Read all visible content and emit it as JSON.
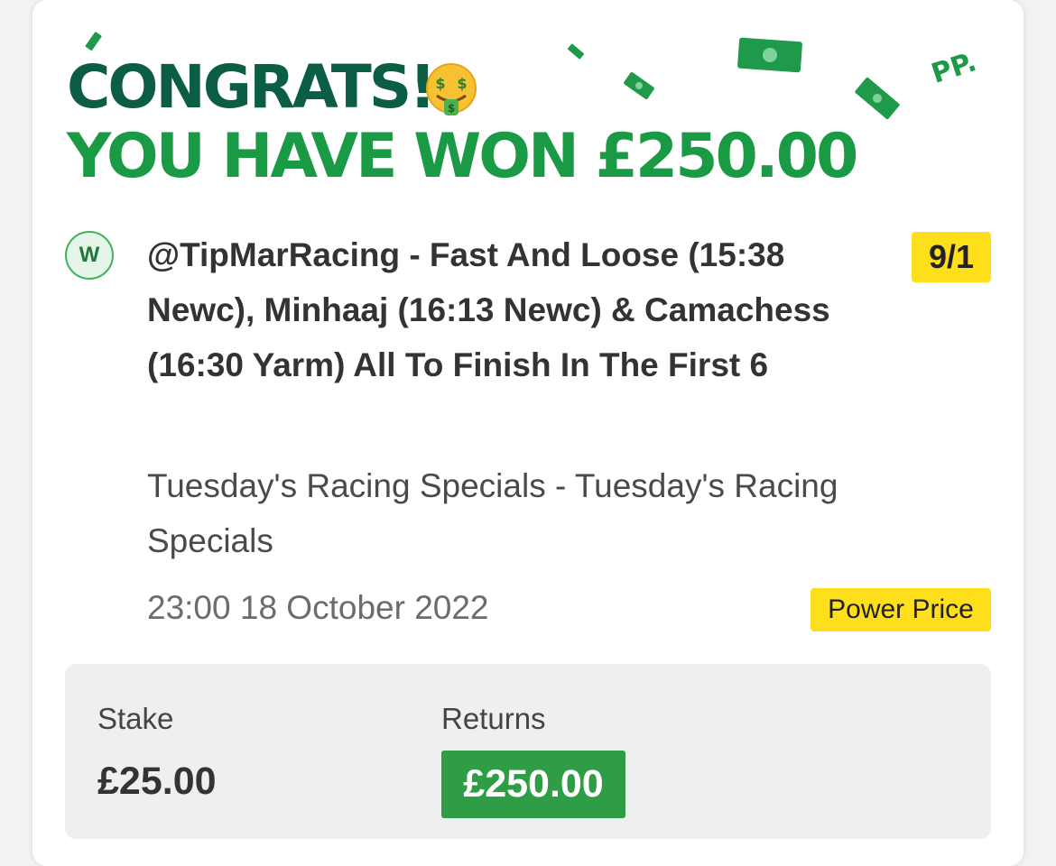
{
  "header": {
    "congrats": "CONGRATS!",
    "won_message": "YOU HAVE WON £250.00",
    "brand_mark": "PP."
  },
  "bet": {
    "status_badge": "W",
    "selection": "@TipMarRacing - Fast And Loose (15:38 Newc), Minhaaj (16:13 Newc) & Camachess (16:30 Yarm) All To Finish In The First 6",
    "odds": "9/1",
    "market": "Tuesday's Racing Specials - Tuesday's Racing Specials",
    "datetime": "23:00 18 October 2022",
    "price_tag": "Power Price"
  },
  "summary": {
    "stake_label": "Stake",
    "stake_value": "£25.00",
    "returns_label": "Returns",
    "returns_value": "£250.00"
  },
  "colors": {
    "dark_green": "#0b5d45",
    "bright_green": "#1a9a44",
    "yellow": "#ffdf1b",
    "returns_green": "#2e9d45"
  },
  "icons": [
    "money-mouth-face-icon",
    "banknote-icon",
    "win-badge-icon"
  ]
}
